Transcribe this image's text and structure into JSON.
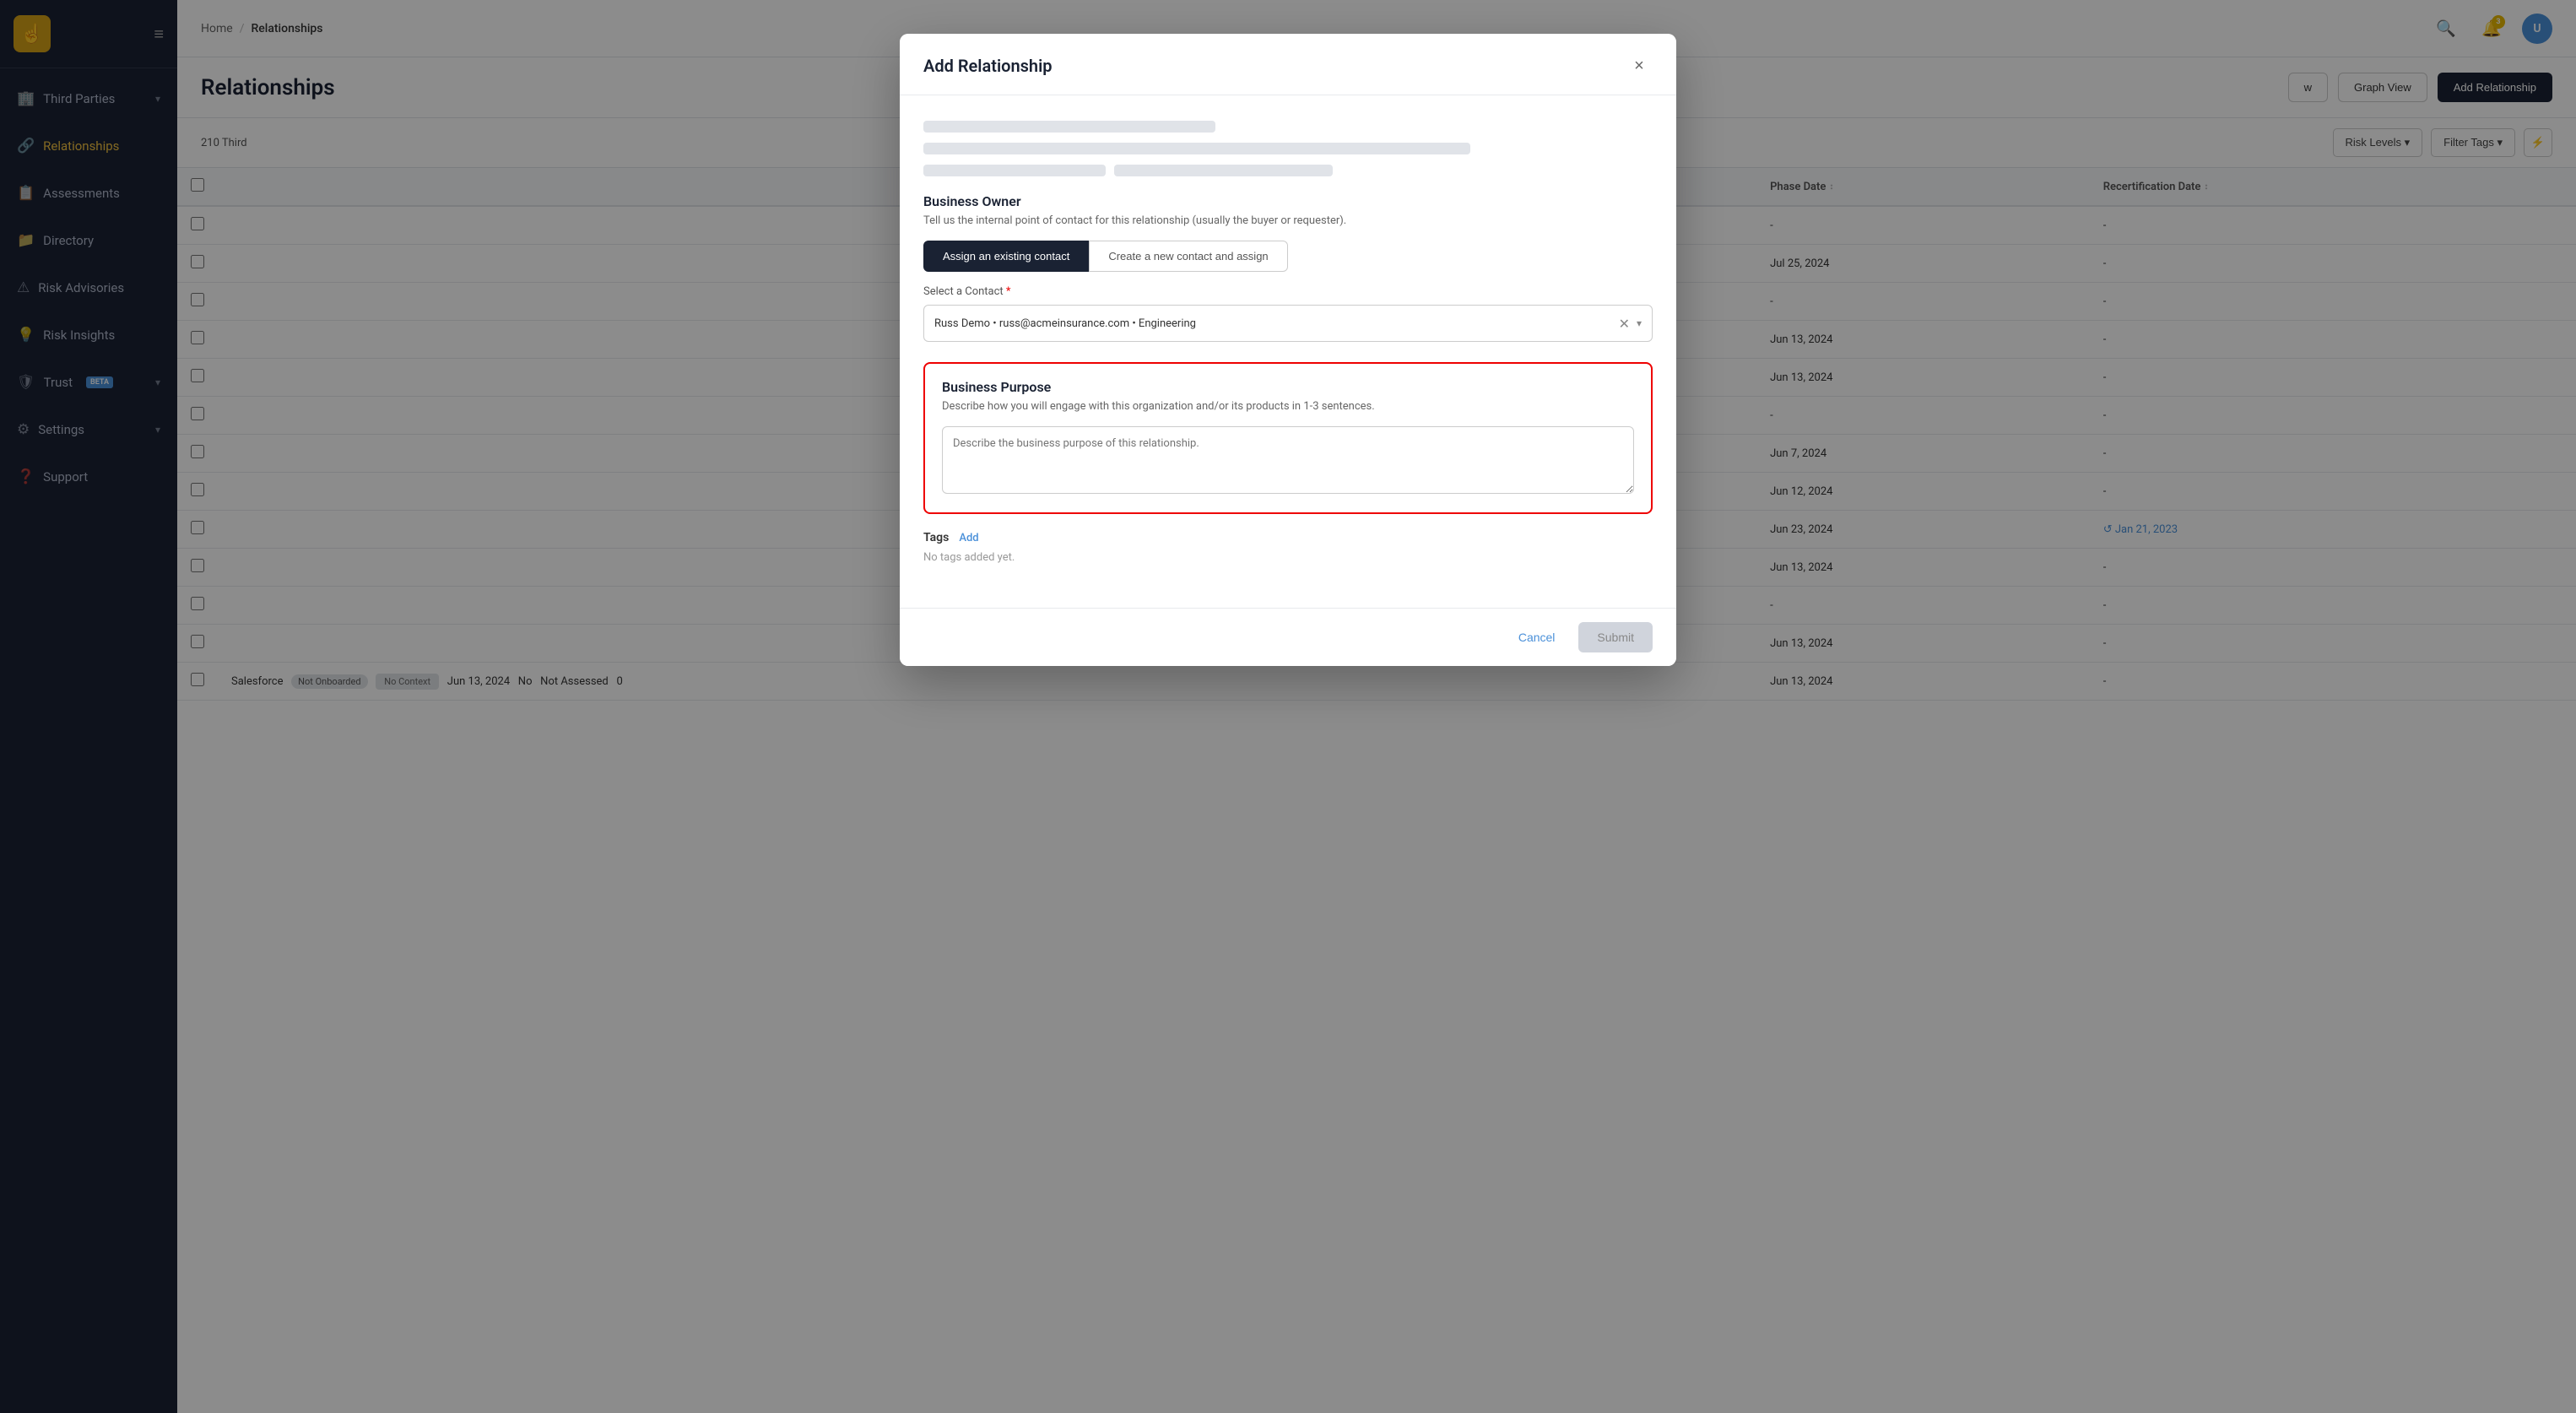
{
  "sidebar": {
    "logo_text": "☝",
    "items": [
      {
        "id": "third-parties",
        "label": "Third Parties",
        "icon": "🏢",
        "has_chevron": true,
        "active": false
      },
      {
        "id": "relationships",
        "label": "Relationships",
        "icon": "🔗",
        "has_chevron": false,
        "active": true
      },
      {
        "id": "assessments",
        "label": "Assessments",
        "icon": "📋",
        "has_chevron": false,
        "active": false
      },
      {
        "id": "directory",
        "label": "Directory",
        "icon": "📁",
        "has_chevron": false,
        "active": false
      },
      {
        "id": "risk-advisories",
        "label": "Risk Advisories",
        "icon": "⚠",
        "has_chevron": false,
        "active": false
      },
      {
        "id": "risk-insights",
        "label": "Risk Insights",
        "icon": "💡",
        "has_chevron": false,
        "active": false
      },
      {
        "id": "trust",
        "label": "Trust",
        "icon": "🛡",
        "has_chevron": true,
        "has_beta": true,
        "active": false
      },
      {
        "id": "settings",
        "label": "Settings",
        "icon": "⚙",
        "has_chevron": true,
        "active": false
      },
      {
        "id": "support",
        "label": "Support",
        "icon": "❓",
        "has_chevron": false,
        "active": false
      }
    ]
  },
  "topbar": {
    "breadcrumbs": [
      "Home",
      "Relationships"
    ],
    "notification_count": "3",
    "avatar_initials": "U"
  },
  "page": {
    "title": "Relationships",
    "third_parties_count": "210 Third",
    "view_button": "w",
    "graph_view": "Graph View",
    "add_relationship": "Add Relationship"
  },
  "filters": {
    "risk_levels": "Risk Levels ▾",
    "filter_tags": "Filter Tags ▾"
  },
  "table": {
    "columns": [
      "",
      "Phase Date ↕",
      "Recertification Date"
    ],
    "rows": [
      {
        "col1": "",
        "phase_date": "",
        "recert_date": "-"
      },
      {
        "col1": "",
        "phase_date": "Jul 25, 2024",
        "recert_date": "-"
      },
      {
        "col1": "",
        "phase_date": "",
        "recert_date": "-"
      },
      {
        "col1": "",
        "phase_date": "Jun 13, 2024",
        "recert_date": "-"
      },
      {
        "col1": "",
        "phase_date": "Jun 13, 2024",
        "recert_date": "-"
      },
      {
        "col1": "",
        "phase_date": "",
        "recert_date": "-"
      },
      {
        "col1": "",
        "phase_date": "Jun 7, 2024",
        "recert_date": "-"
      },
      {
        "col1": "",
        "phase_date": "Jun 12, 2024",
        "recert_date": "-"
      },
      {
        "col1": "",
        "phase_date": "Jun 23, 2024",
        "recert_date": "Jan 21, 2023"
      },
      {
        "col1": "",
        "phase_date": "Jun 13, 2024",
        "recert_date": "-"
      },
      {
        "col1": "",
        "phase_date": "",
        "recert_date": "-"
      },
      {
        "col1": "",
        "phase_date": "Jun 13, 2024",
        "recert_date": "-"
      },
      {
        "col1": "",
        "phase_date": "Jun 13, 2024",
        "recert_date": "-"
      }
    ],
    "bottom_row": {
      "name": "Salesforce",
      "status": "Not Onboarded",
      "context_badge": "No Context",
      "date": "Jun 13, 2024",
      "no": "No",
      "assessment": "Not Assessed",
      "count": "0"
    }
  },
  "modal": {
    "title": "Add Relationship",
    "close_label": "×",
    "business_owner": {
      "section_title": "Business Owner",
      "description": "Tell us the internal point of contact for this relationship (usually the buyer or requester).",
      "tab_existing": "Assign an existing contact",
      "tab_new": "Create a new contact and assign",
      "select_label": "Select a Contact",
      "select_required": true,
      "selected_value": "Russ Demo • russ@acmeinsurance.com • Engineering"
    },
    "business_purpose": {
      "section_title": "Business Purpose",
      "description": "Describe how you will engage with this organization and/or its products in 1-3 sentences.",
      "placeholder": "Describe the business purpose of this relationship."
    },
    "tags": {
      "label": "Tags",
      "add_label": "Add",
      "empty_text": "No tags added yet."
    },
    "footer": {
      "cancel": "Cancel",
      "submit": "Submit"
    }
  }
}
